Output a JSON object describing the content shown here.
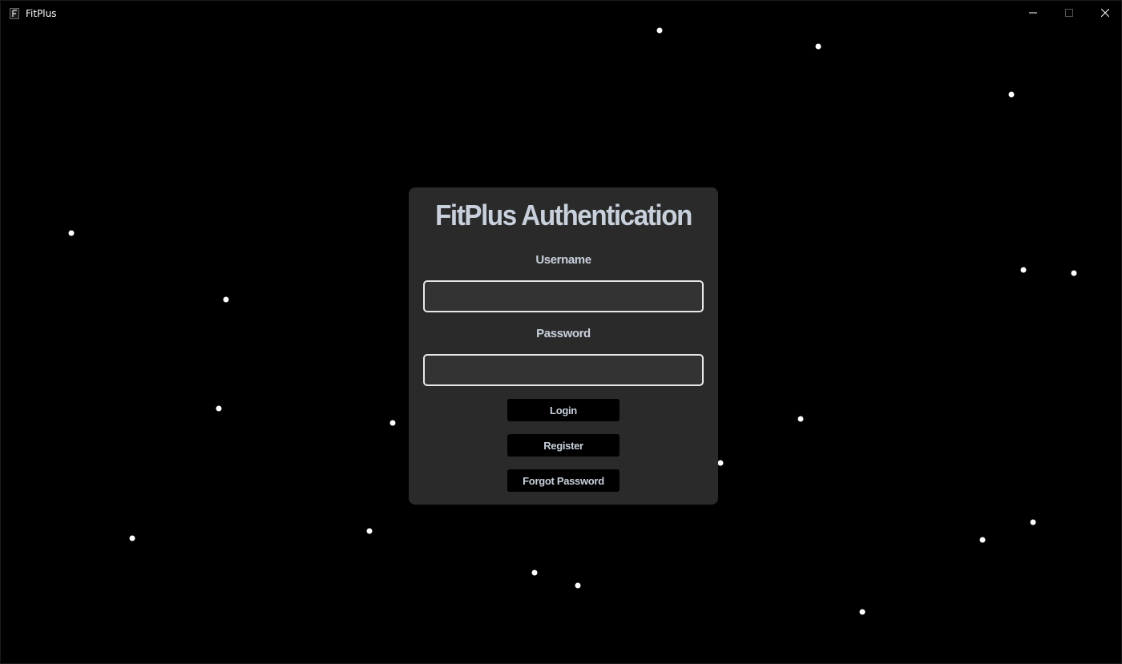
{
  "window": {
    "title": "FitPlus",
    "icon": "fitplus-app-icon",
    "controls": {
      "minimize_icon": "minimize-icon",
      "maximize_icon": "maximize-icon",
      "close_icon": "close-icon"
    }
  },
  "auth_panel": {
    "title": "FitPlus Authentication",
    "username_label": "Username",
    "username_value": "",
    "password_label": "Password",
    "password_value": "",
    "login_label": "Login",
    "register_label": "Register",
    "forgot_password_label": "Forgot Password"
  },
  "colors": {
    "background": "#000000",
    "panel": "#2a2a2a",
    "text": "#c8d0dc",
    "input_bg": "#333333",
    "input_border": "#e8e8e8",
    "button_bg": "#000000",
    "star": "#ffffff"
  }
}
